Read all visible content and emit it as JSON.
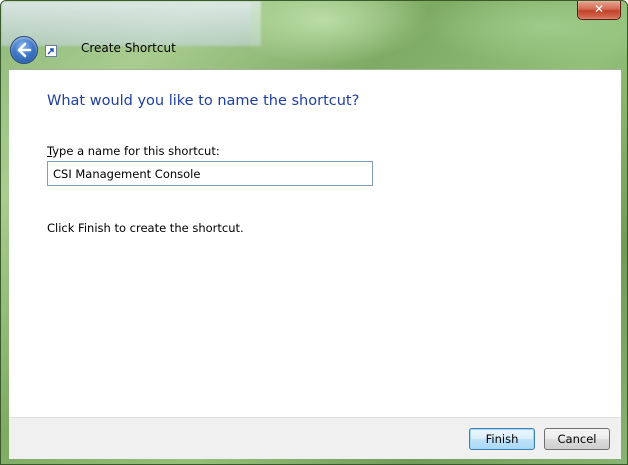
{
  "window": {
    "title": "Create Shortcut",
    "close_label": "✕"
  },
  "icons": {
    "back": "back-arrow-icon",
    "shortcut": "shortcut-icon"
  },
  "page": {
    "heading": "What would you like to name the shortcut?",
    "field_label_accel": "T",
    "field_label_rest": "ype a name for this shortcut:",
    "name_value": "CSI Management Console",
    "hint": "Click Finish to create the shortcut."
  },
  "footer": {
    "finish_label": "Finish",
    "cancel_label": "Cancel"
  }
}
